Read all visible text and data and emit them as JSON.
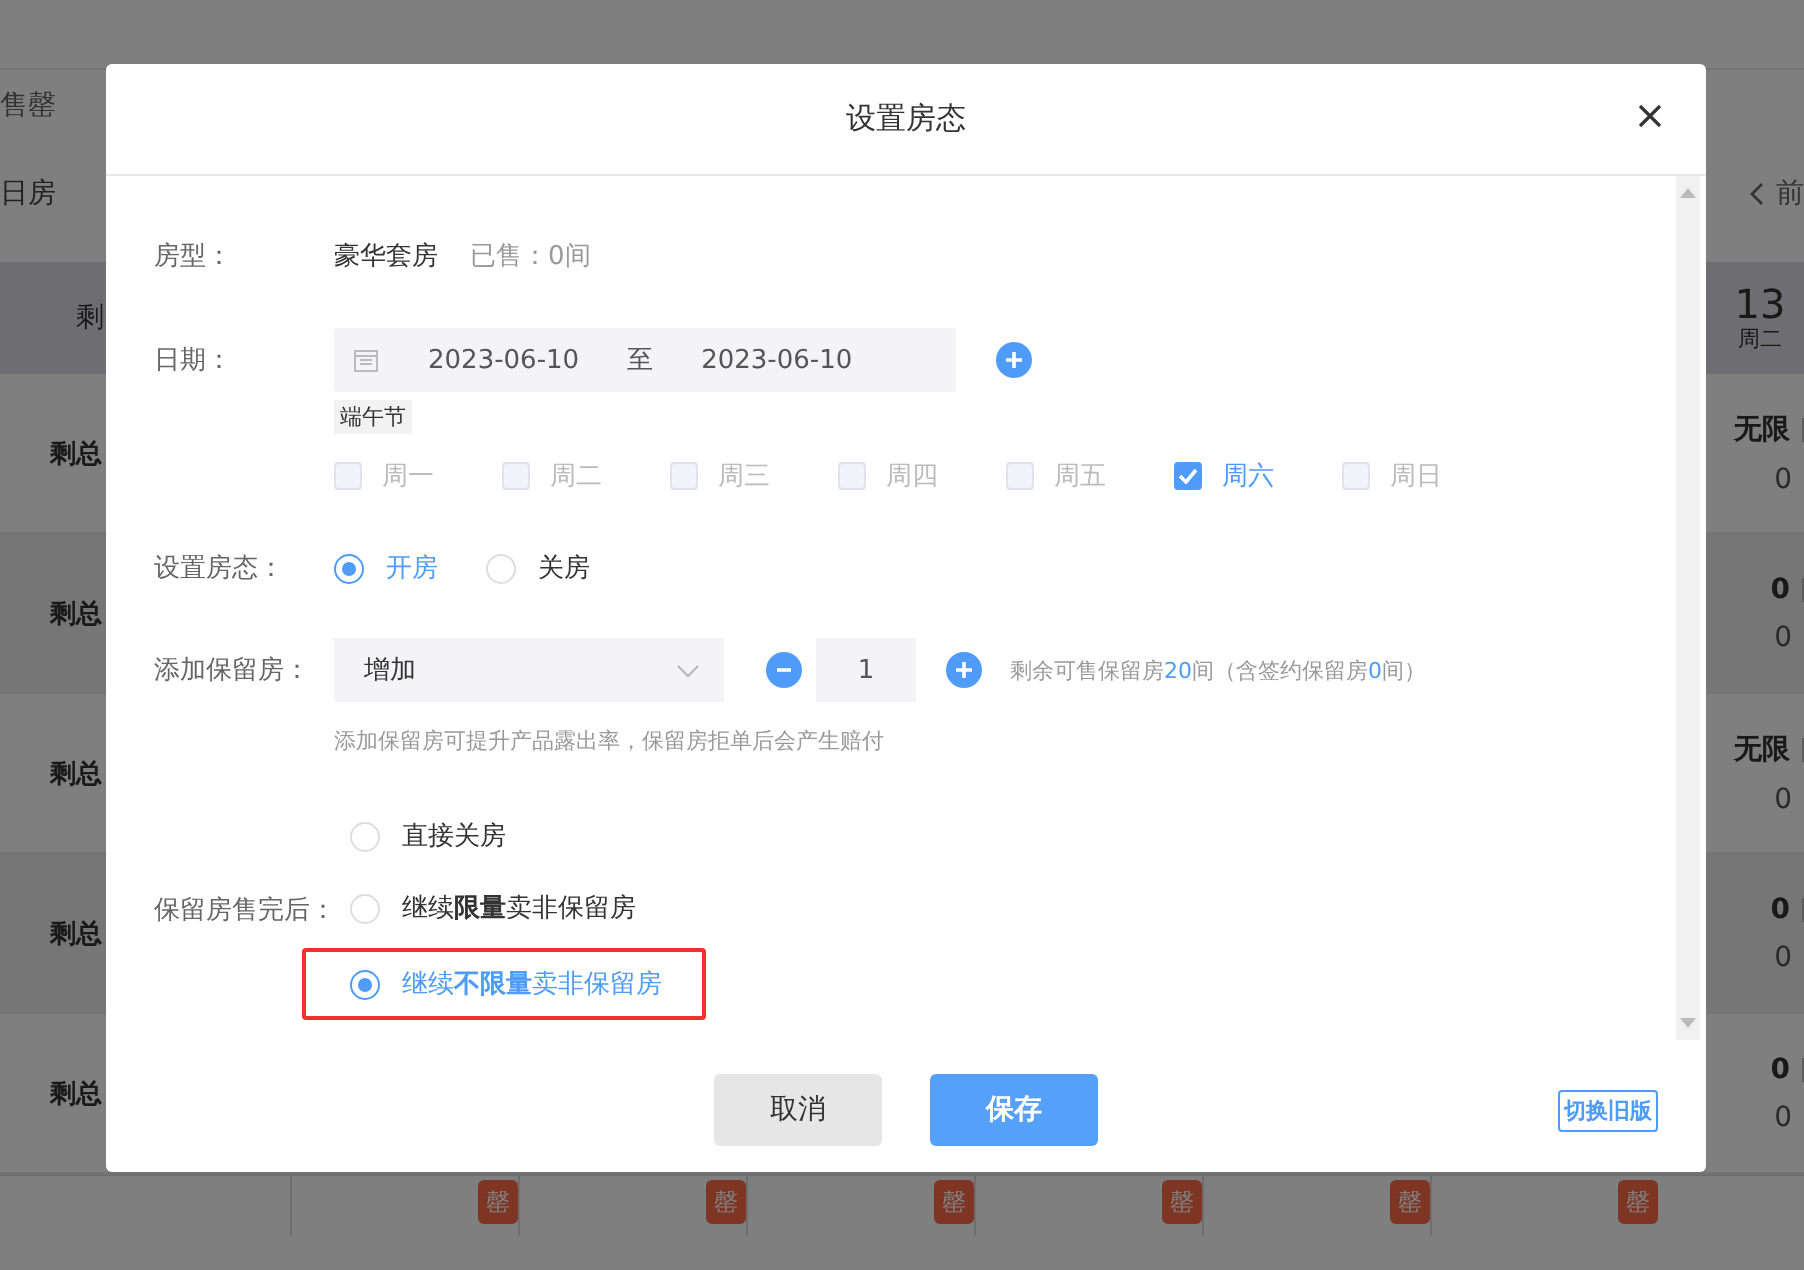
{
  "background_page": {
    "toolbar_text": "售罄",
    "tab_label": "日房",
    "prev_label": "前",
    "header": {
      "left": "剩",
      "date": "13",
      "weekday": "周二"
    },
    "rows": [
      {
        "label": "剩总",
        "total": "无限",
        "reserved": "0"
      },
      {
        "label": "剩总",
        "total": "0",
        "reserved": "0"
      },
      {
        "label": "剩总",
        "total": "无限",
        "reserved": "0"
      },
      {
        "label": "剩总",
        "total": "0",
        "reserved": "0"
      },
      {
        "label": "剩总",
        "total": "0",
        "reserved": "0"
      }
    ],
    "badges": [
      "罄",
      "罄",
      "罄",
      "罄",
      "罄",
      "罄"
    ]
  },
  "dialog": {
    "title": "设置房态",
    "room_type": {
      "label": "房型：",
      "value": "豪华套房",
      "sold": "已售：0间"
    },
    "date": {
      "label": "日期：",
      "start": "2023-06-10",
      "separator": "至",
      "end": "2023-06-10",
      "tag": "端午节"
    },
    "weekdays": [
      {
        "label": "周一",
        "checked": false
      },
      {
        "label": "周二",
        "checked": false
      },
      {
        "label": "周三",
        "checked": false
      },
      {
        "label": "周四",
        "checked": false
      },
      {
        "label": "周五",
        "checked": false
      },
      {
        "label": "周六",
        "checked": true
      },
      {
        "label": "周日",
        "checked": false
      }
    ],
    "status": {
      "label": "设置房态：",
      "options": [
        {
          "label": "开房",
          "selected": true
        },
        {
          "label": "关房",
          "selected": false
        }
      ]
    },
    "reserve": {
      "label": "添加保留房：",
      "action": "增加",
      "quantity": "1",
      "info": [
        {
          "text": "剩余可售保留房",
          "highlight": false
        },
        {
          "text": "20",
          "highlight": true
        },
        {
          "text": "间（含签约保留房",
          "highlight": false
        },
        {
          "text": "0",
          "highlight": true
        },
        {
          "text": "间）",
          "highlight": false
        }
      ],
      "hint": "添加保留房可提升产品露出率，保留房拒单后会产生赔付"
    },
    "after_sold": {
      "label": "保留房售完后：",
      "options": [
        {
          "label": "直接关房",
          "selected": false,
          "highlighted": false
        },
        {
          "label": "继续**限量**卖非保留房",
          "selected": false,
          "highlighted": false
        },
        {
          "label": "继续**不限量**卖非保留房",
          "selected": true,
          "highlighted": true
        }
      ]
    },
    "buttons": {
      "cancel": "取消",
      "save": "保存",
      "switch_version": "切换旧版"
    }
  }
}
